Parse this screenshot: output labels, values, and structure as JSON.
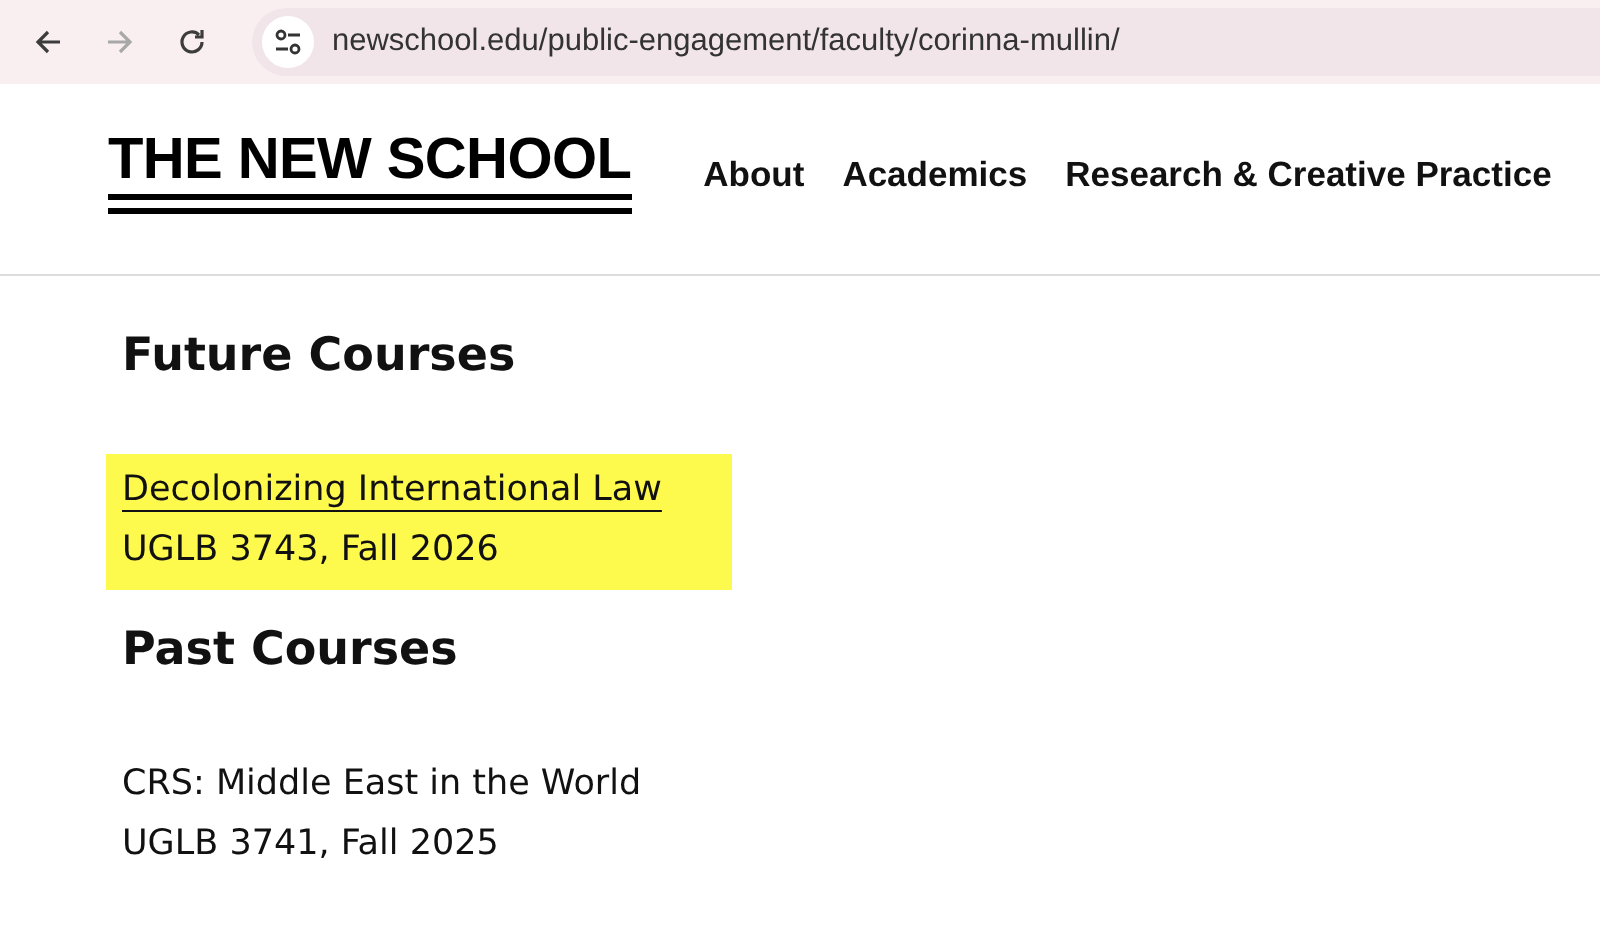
{
  "browser": {
    "back_enabled": true,
    "forward_enabled": false,
    "url": "newschool.edu/public-engagement/faculty/corinna-mullin/"
  },
  "header": {
    "logo": "THE NEW SCHOOL",
    "nav": [
      "About",
      "Academics",
      "Research & Creative Practice"
    ]
  },
  "sections": [
    {
      "heading": "Future Courses",
      "courses": [
        {
          "title": "Decolonizing International Law",
          "kind": "link",
          "details": "UGLB 3743, Fall 2026",
          "highlighted": true
        }
      ]
    },
    {
      "heading": "Past Courses",
      "courses": [
        {
          "title": "CRS: Middle East in the World",
          "kind": "text",
          "details": "UGLB 3741, Fall 2025",
          "highlighted": false
        }
      ]
    }
  ]
}
